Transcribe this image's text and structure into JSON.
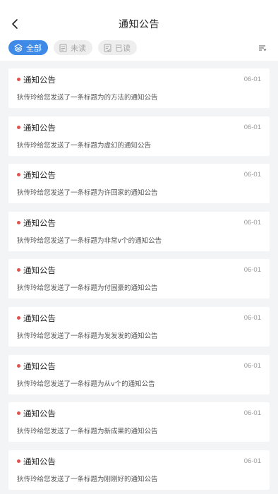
{
  "header": {
    "title": "通知公告",
    "back_icon": "chevron-left-icon"
  },
  "tabs": [
    {
      "label": "全部",
      "icon": "layers-icon",
      "active": true
    },
    {
      "label": "未读",
      "icon": "document-icon",
      "active": false
    },
    {
      "label": "已读",
      "icon": "document-check-icon",
      "active": false
    }
  ],
  "filter_icon": "sort-filter-icon",
  "colors": {
    "accent": "#3e8ae6",
    "unread_dot": "#e0524f",
    "background": "#f3f4f6"
  },
  "notifications": [
    {
      "title": "通知公告",
      "date": "06-01",
      "message": "狄传玲给您发送了一条标题为的方法的通知公告"
    },
    {
      "title": "通知公告",
      "date": "06-01",
      "message": "狄传玲给您发送了一条标题为虚幻的通知公告"
    },
    {
      "title": "通知公告",
      "date": "06-01",
      "message": "狄传玲给您发送了一条标题为许回家的通知公告"
    },
    {
      "title": "通知公告",
      "date": "06-01",
      "message": "狄传玲给您发送了一条标题为非常v个的通知公告"
    },
    {
      "title": "通知公告",
      "date": "06-01",
      "message": "狄传玲给您发送了一条标题为付固豪的通知公告"
    },
    {
      "title": "通知公告",
      "date": "06-01",
      "message": "狄传玲给您发送了一条标题为发发发的通知公告"
    },
    {
      "title": "通知公告",
      "date": "06-01",
      "message": "狄传玲给您发送了一条标题为从v个的通知公告"
    },
    {
      "title": "通知公告",
      "date": "06-01",
      "message": "狄传玲给您发送了一条标题为新成果的通知公告"
    },
    {
      "title": "通知公告",
      "date": "06-01",
      "message": "狄传玲给您发送了一条标题为刚刚好的通知公告"
    }
  ]
}
